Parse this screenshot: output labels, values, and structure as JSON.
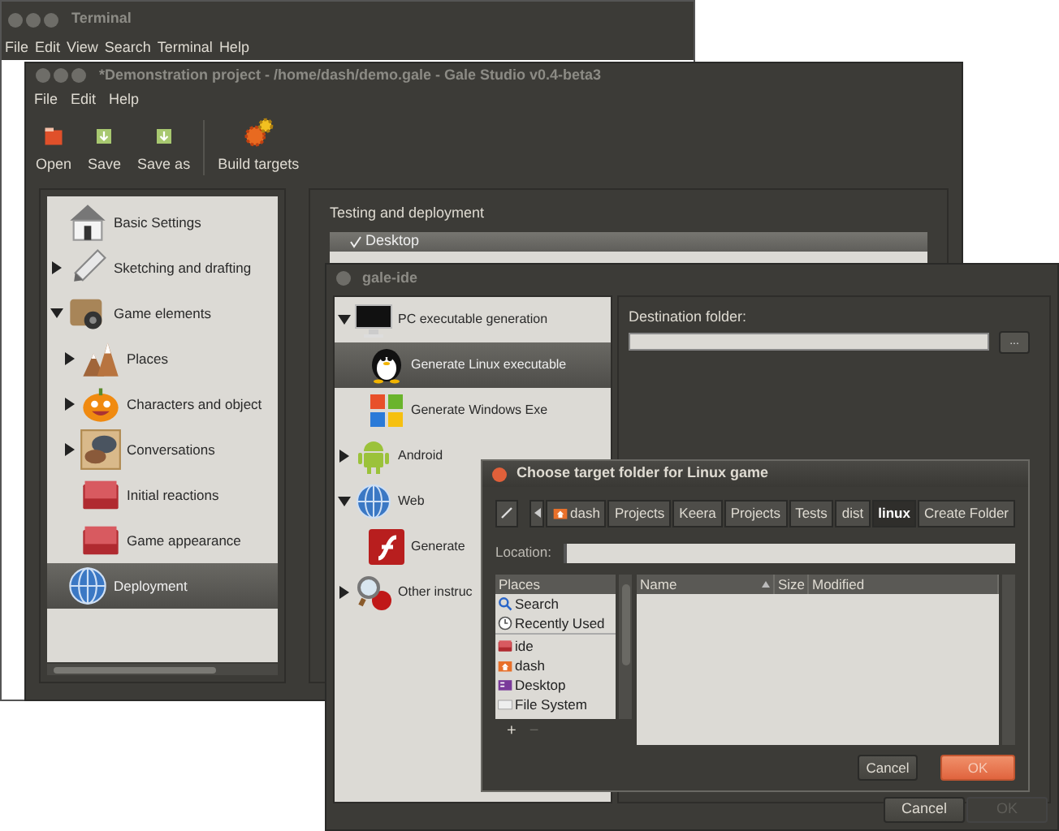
{
  "terminal_window": {
    "title": "Terminal",
    "menu": [
      "File",
      "Edit",
      "View",
      "Search",
      "Terminal",
      "Help"
    ]
  },
  "main_window": {
    "title": "*Demonstration project - /home/dash/demo.gale - Gale Studio v0.4-beta3",
    "menu": [
      "File",
      "Edit",
      "Help"
    ],
    "toolbar": [
      "Open",
      "Save",
      "Save as",
      "Build targets"
    ],
    "sidebar": {
      "items": [
        {
          "label": "Basic Settings",
          "selected": false
        },
        {
          "label": "Sketching and drafting",
          "expanded": false,
          "selected": false
        },
        {
          "label": "Game elements",
          "expanded": true,
          "selected": false,
          "children": [
            {
              "label": "Places",
              "expanded": false,
              "selected": false
            },
            {
              "label": "Characters and object",
              "expanded": false,
              "selected": false
            },
            {
              "label": "Conversations",
              "expanded": false,
              "selected": false
            },
            {
              "label": "Initial reactions",
              "selected": false
            },
            {
              "label": "Game appearance",
              "selected": false
            }
          ]
        },
        {
          "label": "Deployment",
          "selected": true
        }
      ]
    },
    "deployment": {
      "heading": "Testing and deployment",
      "targets": [
        {
          "label": "Desktop",
          "checked": true
        }
      ]
    }
  },
  "ide_window": {
    "title": "gale-ide",
    "tree": [
      {
        "label": "PC executable generation",
        "expanded": true,
        "selected": false,
        "children": [
          {
            "label": "Generate Linux executable",
            "selected": true
          },
          {
            "label": "Generate Windows Exe",
            "selected": false
          }
        ]
      },
      {
        "label": "Android",
        "expanded": false,
        "selected": false
      },
      {
        "label": "Web",
        "expanded": true,
        "selected": false,
        "children": [
          {
            "label": "Generate",
            "selected": false
          }
        ]
      },
      {
        "label": "Other instruc",
        "expanded": false,
        "selected": false
      }
    ],
    "destination_label": "Destination folder:",
    "browse_button": "...",
    "buttons": [
      {
        "label": "Cancel",
        "disabled": false
      },
      {
        "label": "OK",
        "disabled": true
      }
    ]
  },
  "dialog": {
    "title": "Choose target folder for Linux game",
    "path": [
      {
        "label": "dash",
        "selected": false
      },
      {
        "label": "Projects",
        "selected": false
      },
      {
        "label": "Keera",
        "selected": false
      },
      {
        "label": "Projects",
        "selected": false
      },
      {
        "label": "Tests",
        "selected": false
      },
      {
        "label": "dist",
        "selected": false
      },
      {
        "label": "linux",
        "selected": true
      }
    ],
    "create_folder": "Create Folder",
    "location_label": "Location:",
    "places_heading": "Places",
    "places": [
      "Search",
      "Recently Used",
      "ide",
      "dash",
      "Desktop",
      "File System"
    ],
    "add": "+",
    "remove": "−",
    "columns": [
      "Name",
      "Size",
      "Modified"
    ],
    "buttons": [
      {
        "label": "Cancel",
        "kind": "normal"
      },
      {
        "label": "OK",
        "kind": "default"
      }
    ]
  }
}
